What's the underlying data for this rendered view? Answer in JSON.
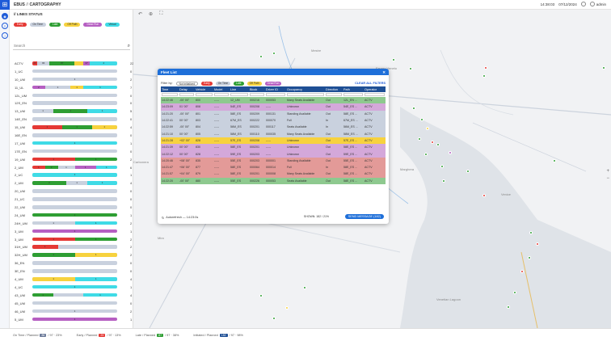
{
  "header": {
    "app": "EBUS",
    "section": "CARTOGRAPHY",
    "time": "14:38:03",
    "date": "07/12/2024",
    "user": "admin"
  },
  "panel": {
    "title": "// LINES STATUS",
    "search_placeholder": "Search",
    "chips": [
      {
        "label": "Early",
        "bg": "#e53935",
        "fg": "#fff"
      },
      {
        "label": "On Time",
        "bg": "#c9d1de",
        "fg": "#333"
      },
      {
        "label": "Late",
        "bg": "#2e9e33",
        "fg": "#fff"
      },
      {
        "label": "Off Path",
        "bg": "#f7d23e",
        "fg": "#333"
      },
      {
        "label": "Dead Run",
        "bg": "#b65fc2",
        "fg": "#fff"
      },
      {
        "label": "Virtual",
        "bg": "#3fdbe6",
        "fg": "#333"
      }
    ],
    "rows": [
      {
        "label": "ACTV",
        "total": "226",
        "segs": [
          {
            "c": "#e53935",
            "w": 6,
            "t": "29"
          },
          {
            "c": "#c9d1de",
            "w": 14,
            "t": "96"
          },
          {
            "c": "#2e9e33",
            "w": 30,
            "t": "87"
          },
          {
            "c": "#f7d23e",
            "w": 10,
            "t": ""
          },
          {
            "c": "#b65fc2",
            "w": 8,
            "t": "27"
          },
          {
            "c": "#3fdbe6",
            "w": 32,
            "t": "4"
          }
        ]
      },
      {
        "label": "1_UC",
        "total": "0",
        "segs": [
          {
            "c": "#c9d1de",
            "w": 100,
            "t": ""
          }
        ]
      },
      {
        "label": "10_UM",
        "total": "2",
        "segs": [
          {
            "c": "#c9d1de",
            "w": 100,
            "t": "1"
          }
        ]
      },
      {
        "label": "11_UL",
        "total": "7",
        "segs": [
          {
            "c": "#b65fc2",
            "w": 15,
            "t": "2"
          },
          {
            "c": "#c9d1de",
            "w": 30,
            "t": "1"
          },
          {
            "c": "#f7d23e",
            "w": 15,
            "t": "1"
          },
          {
            "c": "#3fdbe6",
            "w": 40,
            "t": "1"
          }
        ]
      },
      {
        "label": "12L_UM",
        "total": "0",
        "segs": [
          {
            "c": "#c9d1de",
            "w": 100,
            "t": ""
          }
        ]
      },
      {
        "label": "12S_EN",
        "total": "0",
        "segs": [
          {
            "c": "#c9d1de",
            "w": 100,
            "t": ""
          }
        ]
      },
      {
        "label": "13_UM",
        "total": "5",
        "segs": [
          {
            "c": "#c9d1de",
            "w": 25,
            "t": "1"
          },
          {
            "c": "#2e9e33",
            "w": 40,
            "t": "1"
          },
          {
            "c": "#3fdbe6",
            "w": 35,
            "t": "1"
          }
        ]
      },
      {
        "label": "14E_EN",
        "total": "0",
        "segs": [
          {
            "c": "#c9d1de",
            "w": 100,
            "t": ""
          }
        ]
      },
      {
        "label": "15_UM",
        "total": "4",
        "segs": [
          {
            "c": "#e53935",
            "w": 35,
            "t": "1"
          },
          {
            "c": "#2e9e33",
            "w": 35,
            "t": "1"
          },
          {
            "c": "#f7d23e",
            "w": 30,
            "t": "1"
          }
        ]
      },
      {
        "label": "16E_EN",
        "total": "0",
        "segs": [
          {
            "c": "#c9d1de",
            "w": 100,
            "t": ""
          }
        ]
      },
      {
        "label": "17_UM",
        "total": "1",
        "segs": [
          {
            "c": "#3fdbe6",
            "w": 100,
            "t": "1"
          }
        ]
      },
      {
        "label": "17E_EN",
        "total": "0",
        "segs": [
          {
            "c": "#c9d1de",
            "w": 100,
            "t": ""
          }
        ]
      },
      {
        "label": "19_UM",
        "total": "2",
        "segs": [
          {
            "c": "#e53935",
            "w": 50,
            "t": "1"
          },
          {
            "c": "#2e9e33",
            "w": 50,
            "t": "1"
          }
        ]
      },
      {
        "label": "2_UM",
        "total": "6",
        "segs": [
          {
            "c": "#e53935",
            "w": 15,
            "t": "1"
          },
          {
            "c": "#2e9e33",
            "w": 15,
            "t": "2"
          },
          {
            "c": "#c9d1de",
            "w": 20,
            "t": "1"
          },
          {
            "c": "#b65fc2",
            "w": 25,
            "t": "1"
          },
          {
            "c": "#3fdbe6",
            "w": 25,
            "t": "1"
          }
        ]
      },
      {
        "label": "2_UC",
        "total": "1",
        "segs": [
          {
            "c": "#3fdbe6",
            "w": 100,
            "t": "1"
          }
        ]
      },
      {
        "label": "2_UM",
        "total": "4",
        "segs": [
          {
            "c": "#2e9e33",
            "w": 40,
            "t": "2"
          },
          {
            "c": "#c9d1de",
            "w": 25,
            "t": "1"
          },
          {
            "c": "#3fdbe6",
            "w": 35,
            "t": "1"
          }
        ]
      },
      {
        "label": "20_UM",
        "total": "0",
        "segs": [
          {
            "c": "#c9d1de",
            "w": 100,
            "t": ""
          }
        ]
      },
      {
        "label": "21_UC",
        "total": "0",
        "segs": [
          {
            "c": "#c9d1de",
            "w": 100,
            "t": ""
          }
        ]
      },
      {
        "label": "22_UM",
        "total": "0",
        "segs": [
          {
            "c": "#c9d1de",
            "w": 100,
            "t": ""
          }
        ]
      },
      {
        "label": "24_UM",
        "total": "1",
        "segs": [
          {
            "c": "#2e9e33",
            "w": 100,
            "t": "1"
          }
        ]
      },
      {
        "label": "24H_UM",
        "total": "2",
        "segs": [
          {
            "c": "#c9d1de",
            "w": 50,
            "t": "1"
          },
          {
            "c": "#3fdbe6",
            "w": 50,
            "t": "1"
          }
        ]
      },
      {
        "label": "3_UM",
        "total": "1",
        "segs": [
          {
            "c": "#b65fc2",
            "w": 100,
            "t": "1"
          }
        ]
      },
      {
        "label": "3_UM",
        "total": "2",
        "segs": [
          {
            "c": "#e53935",
            "w": 50,
            "t": "1"
          },
          {
            "c": "#2e9e33",
            "w": 50,
            "t": "1"
          }
        ]
      },
      {
        "label": "31H_UM",
        "total": "2",
        "segs": [
          {
            "c": "#e53935",
            "w": 30,
            "t": "1"
          },
          {
            "c": "#c9d1de",
            "w": 70,
            "t": ""
          }
        ]
      },
      {
        "label": "32H_UM",
        "total": "2",
        "segs": [
          {
            "c": "#2e9e33",
            "w": 50,
            "t": "1"
          },
          {
            "c": "#f7d23e",
            "w": 50,
            "t": "1"
          }
        ]
      },
      {
        "label": "36_EN",
        "total": "0",
        "segs": [
          {
            "c": "#c9d1de",
            "w": 100,
            "t": ""
          }
        ]
      },
      {
        "label": "3E_EN",
        "total": "0",
        "segs": [
          {
            "c": "#c9d1de",
            "w": 100,
            "t": ""
          }
        ]
      },
      {
        "label": "4_UM",
        "total": "4",
        "segs": [
          {
            "c": "#f7d23e",
            "w": 50,
            "t": "1"
          },
          {
            "c": "#3fdbe6",
            "w": 50,
            "t": "1"
          }
        ]
      },
      {
        "label": "4_UC",
        "total": "1",
        "segs": [
          {
            "c": "#3fdbe6",
            "w": 100,
            "t": "1"
          }
        ]
      },
      {
        "label": "43_UM",
        "total": "4",
        "segs": [
          {
            "c": "#2e9e33",
            "w": 25,
            "t": "1"
          },
          {
            "c": "#c9d1de",
            "w": 35,
            "t": ""
          },
          {
            "c": "#3fdbe6",
            "w": 40,
            "t": "1"
          }
        ]
      },
      {
        "label": "45_UM",
        "total": "0",
        "segs": [
          {
            "c": "#c9d1de",
            "w": 100,
            "t": ""
          }
        ]
      },
      {
        "label": "46_UM",
        "total": "2",
        "segs": [
          {
            "c": "#c9d1de",
            "w": 100,
            "t": "1"
          }
        ]
      },
      {
        "label": "5_UM",
        "total": "1",
        "segs": [
          {
            "c": "#b65fc2",
            "w": 100,
            "t": "1"
          }
        ]
      }
    ]
  },
  "footer": [
    {
      "label": "On Time / Planned",
      "badge": "86",
      "bc": "#6b7a99",
      "pct": "/ 97 · 23%"
    },
    {
      "label": "Early / Planned",
      "badge": "29",
      "bc": "#e53935",
      "pct": "/ 97 · 13%"
    },
    {
      "label": "Late / Planned",
      "badge": "87",
      "bc": "#2e9e33",
      "pct": "/ 97 · 38%"
    },
    {
      "label": "Initiated / Planned",
      "badge": "182",
      "bc": "#1e4f95",
      "pct": "/ 97 · 98%"
    }
  ],
  "dialog": {
    "title": "Fleet List",
    "filter_label": "Filter by:",
    "filter_value": "Not initialized",
    "clear": "CLEAR ALL FILTERS",
    "autorefresh": "Autorefresh — 14:23:0s",
    "shown": "SHOWN: 182 / 21%",
    "send": "SEND MESSAGE (182)",
    "filters": [
      {
        "label": "Early",
        "bg": "#e53935",
        "fg": "#fff"
      },
      {
        "label": "On Time",
        "bg": "#c9d1de",
        "fg": "#333"
      },
      {
        "label": "Late",
        "bg": "#2e9e33",
        "fg": "#fff"
      },
      {
        "label": "Off Path",
        "bg": "#f7d23e",
        "fg": "#333"
      },
      {
        "label": "Dead Run",
        "bg": "#b65fc2",
        "fg": "#fff"
      }
    ],
    "columns": [
      "Time",
      "Delay",
      "Vehicle",
      "Model",
      "Line",
      "Block",
      "Driver ID",
      "Occupancy",
      "Direction",
      "Path",
      "Operator"
    ],
    "rows": [
      {
        "bg": "#8ec98f",
        "c": [
          "14:22:46",
          "-00' 00\"",
          "800",
          "-----",
          "12_UM",
          "000216",
          "000053",
          "Many Seats Available",
          "Out",
          "12L_EN ...",
          "ACTV"
        ]
      },
      {
        "bg": "#d4a8da",
        "c": [
          "14:23:09",
          "01' 00\"",
          "808",
          "-----",
          "54E_ES",
          "000208",
          "-----",
          "Unknown",
          "Out",
          "54E_ES ...",
          "ACTV"
        ]
      },
      {
        "bg": "#c9d1de",
        "c": [
          "14:21:20",
          "-00' 00\"",
          "801",
          "-----",
          "58E_ES",
          "000209",
          "000131",
          "Standing Available",
          "Out",
          "58E_ES ...",
          "ACTV"
        ]
      },
      {
        "bg": "#c9d1de",
        "c": [
          "14:22:41",
          "00' 00\"",
          "803",
          "-----",
          "67M_ES",
          "000222",
          "000070",
          "Full",
          "In",
          "67M_ES ...",
          "ACTV"
        ]
      },
      {
        "bg": "#c9d1de",
        "c": [
          "14:22:59",
          "-00' 00\"",
          "804",
          "-----",
          "56M_ES",
          "000201",
          "000117",
          "Seats Available",
          "In",
          "56M_ES ...",
          "ACTV"
        ]
      },
      {
        "bg": "#c9d1de",
        "c": [
          "14:21:10",
          "00' 00\"",
          "805",
          "-----",
          "58M_ES",
          "000110",
          "000035",
          "Many Seats Available",
          "Out",
          "58M_ES ...",
          "ACTV"
        ]
      },
      {
        "bg": "#f7d23e",
        "c": [
          "14:21:28",
          "+02' 00\"",
          "828",
          "-----",
          "57E_ES",
          "000208",
          "-----",
          "Unknown",
          "Out",
          "57E_ES ...",
          "ACTV"
        ]
      },
      {
        "bg": "#d4a8da",
        "c": [
          "14:21:39",
          "00' 00\"",
          "830",
          "-----",
          "58E_ES",
          "000201",
          "-----",
          "Unknown",
          "Out",
          "58E_ES ...",
          "ACTV"
        ]
      },
      {
        "bg": "#d4a8da",
        "c": [
          "14:22:12",
          "00' 00\"",
          "828",
          "-----",
          "59E_ES",
          "000203",
          "-----",
          "Unknown",
          "Out",
          "59E_ES ...",
          "ACTV"
        ]
      },
      {
        "bg": "#e39a98",
        "c": [
          "14:20:46",
          "+08' 00\"",
          "835",
          "-----",
          "55E_ES",
          "000203",
          "000001",
          "Standing Available",
          "Out",
          "55E_ES ...",
          "ACTV"
        ]
      },
      {
        "bg": "#e39a98",
        "c": [
          "14:21:47",
          "+06' 00\"",
          "877",
          "-----",
          "58E_ES",
          "000064",
          "000014",
          "Full",
          "In",
          "58E_ES ...",
          "ACTV"
        ]
      },
      {
        "bg": "#e39a98",
        "c": [
          "14:21:57",
          "+04' 00\"",
          "879",
          "-----",
          "58E_ES",
          "000201",
          "000008",
          "Many Seats Available",
          "Out",
          "58E_ES ...",
          "ACTV"
        ]
      },
      {
        "bg": "#8ec98f",
        "c": [
          "14:22:20",
          "-00' 00\"",
          "880",
          "-----",
          "55E_ES",
          "000226",
          "000053",
          "Seats Available",
          "Out",
          "58E_ES ...",
          "ACTV"
        ]
      }
    ]
  },
  "map": {
    "place_labels": [
      "Mestre",
      "Venice",
      "Venetian Lagoon",
      "Marghera",
      "Carbonera",
      "Oriago",
      "Mira",
      "Chirignago",
      "Favaro Veneto"
    ],
    "zoom_in": "+",
    "zoom_out": "−"
  }
}
